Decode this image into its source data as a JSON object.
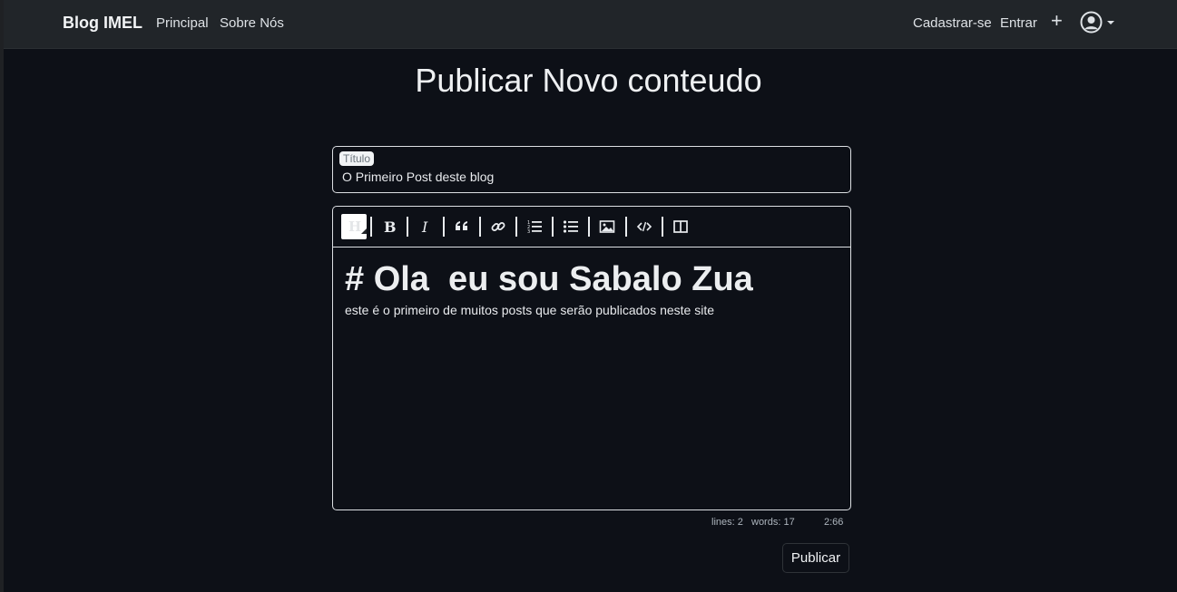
{
  "navbar": {
    "brand": "Blog IMEL",
    "links": [
      "Principal",
      "Sobre Nós"
    ],
    "right_links": [
      "Cadastrar-se",
      "Entrar"
    ],
    "plus_label": "+",
    "icons": [
      "plus-icon",
      "user-circle-icon",
      "caret-down-icon"
    ]
  },
  "page": {
    "title": "Publicar Novo conteudo"
  },
  "form": {
    "title_label": "Título",
    "title_value": "O Primeiro Post deste blog"
  },
  "editor": {
    "toolbar": [
      "heading-icon",
      "bold-icon",
      "italic-icon",
      "quote-icon",
      "link-icon",
      "ordered-list-icon",
      "unordered-list-icon",
      "image-icon",
      "code-icon",
      "side-by-side-icon"
    ],
    "content": {
      "line1": "# Ola  eu sou Sabalo Zua",
      "line2": "este é o primeiro de muitos posts que serão publicados neste site"
    },
    "status": {
      "lines": "lines: 2",
      "words": "words: 17",
      "cursor": "2:66"
    }
  },
  "actions": {
    "publish_label": "Publicar"
  },
  "colors": {
    "background": "#0d1017",
    "navbar": "#212529",
    "border": "#dcdfe3"
  }
}
